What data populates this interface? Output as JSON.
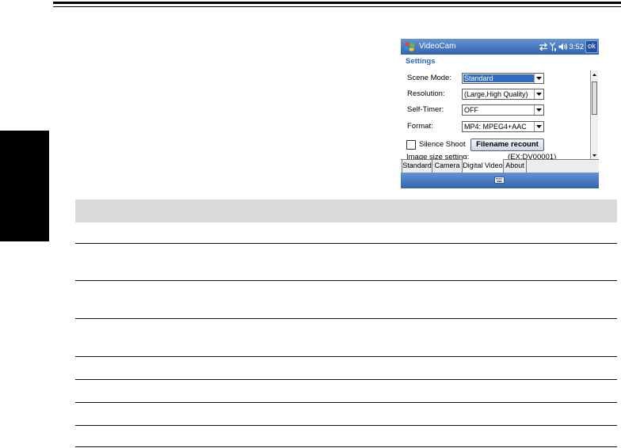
{
  "window": {
    "start_icon": "windows-start-icon",
    "app_title": "VideoCam",
    "tray_icons": [
      "connectivity-icon",
      "signal-icon",
      "volume-icon"
    ],
    "time": "3:52",
    "ok_label": "ok"
  },
  "settings": {
    "heading": "Settings",
    "fields": [
      {
        "label": "Scene Mode:",
        "value": "Standard",
        "focused": true
      },
      {
        "label": "Resolution:",
        "value": "(Large,High Quality)",
        "focused": false
      },
      {
        "label": "Self-Timer:",
        "value": "OFF",
        "focused": false
      },
      {
        "label": "Format:",
        "value": "MP4: MPEG4+AAC",
        "focused": false
      }
    ],
    "silence_shoot": {
      "label": "Silence Shoot",
      "checked": false
    },
    "filename_recount_label": "Filename recount",
    "image_size_label": "Image size setting:",
    "image_size_hint": "(EX:DV00001)"
  },
  "tabs": [
    {
      "label": "Standard",
      "selected": false
    },
    {
      "label": "Camera",
      "selected": false
    },
    {
      "label": "Digital Video",
      "selected": true
    },
    {
      "label": "About",
      "selected": false
    }
  ],
  "menu_bar": {
    "icon": "keyboard-icon"
  },
  "colors": {
    "title_bar": "#3a74c8",
    "heading_text": "#2a64c8",
    "selection": "#316ac5",
    "table_header": "#d9d9d9",
    "section_tab": "#000000"
  }
}
